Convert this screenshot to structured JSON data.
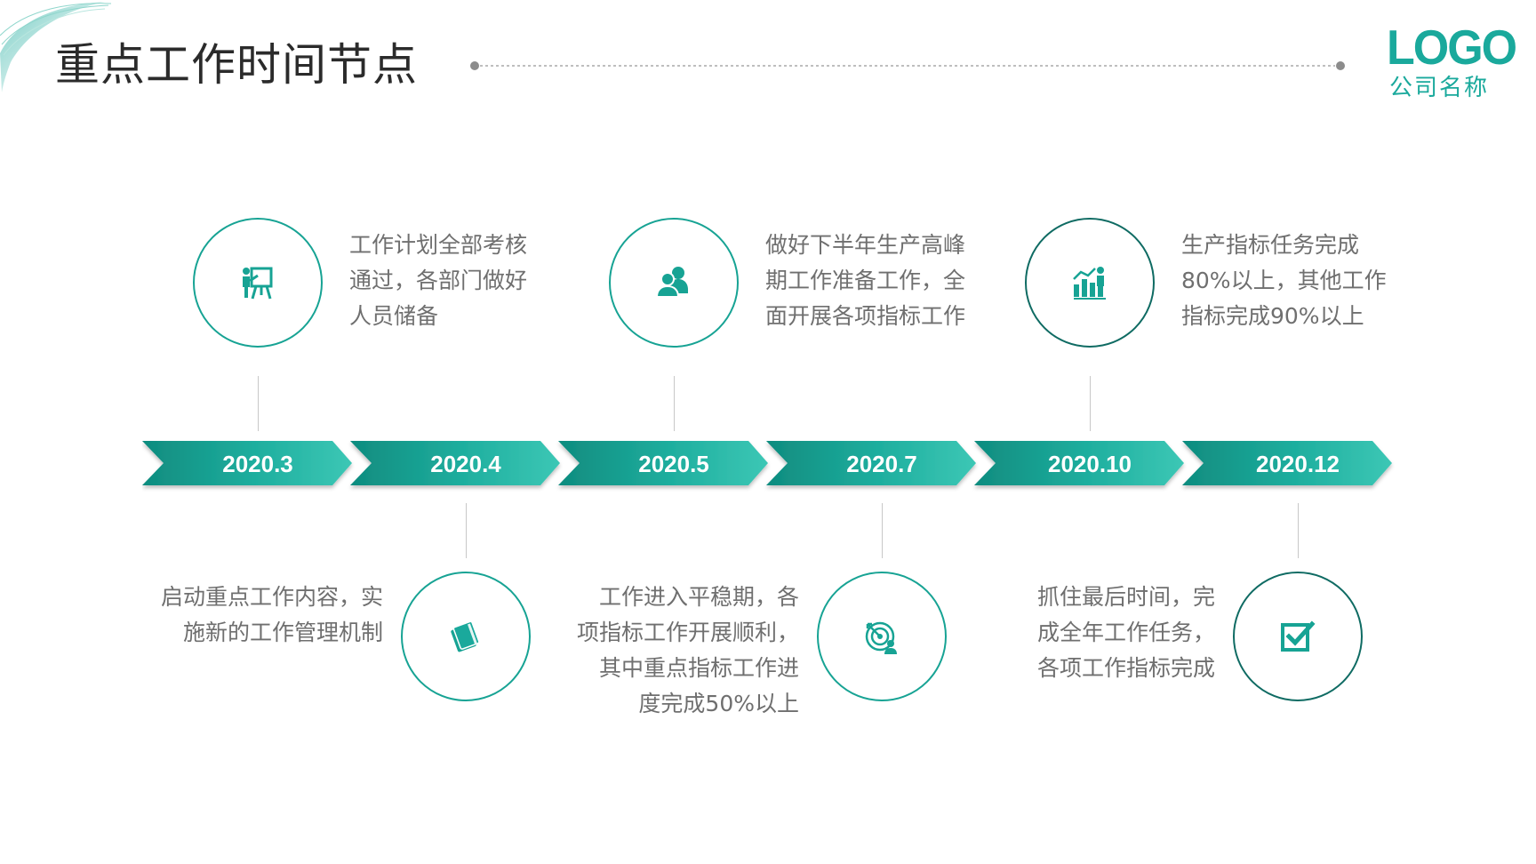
{
  "header": {
    "title": "重点工作时间节点"
  },
  "logo": {
    "mark": "LOGO",
    "company": "公司名称"
  },
  "colors": {
    "accent": "#1aa99c",
    "arrow_light": "#2fbfad",
    "arrow_dark": "#0f8c7f",
    "text": "#6f6f6f"
  },
  "timeline": [
    {
      "date": "2020.3",
      "icon": "presentation-icon",
      "position": "top",
      "lines": [
        "工作计划全部考核",
        "通过，各部门做好",
        "人员储备"
      ]
    },
    {
      "date": "2020.4",
      "icon": "book-icon",
      "position": "bottom",
      "lines": [
        "启动重点工作内容，实",
        "施新的工作管理机制"
      ]
    },
    {
      "date": "2020.5",
      "icon": "team-icon",
      "position": "top",
      "lines": [
        "做好下半年生产高峰",
        "期工作准备工作，全",
        "面开展各项指标工作"
      ]
    },
    {
      "date": "2020.7",
      "icon": "target-icon",
      "position": "bottom",
      "lines": [
        "工作进入平稳期，各",
        "项指标工作开展顺利，",
        "其中重点指标工作进",
        "度完成50%以上"
      ]
    },
    {
      "date": "2020.10",
      "icon": "growth-chart-icon",
      "position": "top",
      "lines": [
        "生产指标任务完成",
        "80%以上，其他工作",
        "指标完成90%以上"
      ]
    },
    {
      "date": "2020.12",
      "icon": "checkbox-icon",
      "position": "bottom",
      "lines": [
        "抓住最后时间，完",
        "成全年工作任务，",
        "各项工作指标完成"
      ]
    }
  ]
}
